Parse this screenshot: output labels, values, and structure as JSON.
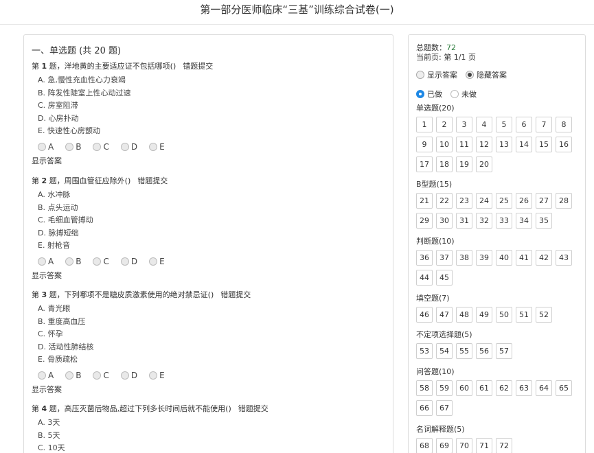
{
  "page": {
    "title": "第一部分医师临床“三基”训练综合试卷(一)"
  },
  "section": {
    "prefix": "一、单选题 (共 ",
    "count": "20",
    "suffix": " 题)"
  },
  "questions": [
    {
      "prefix": "第 ",
      "num": "1",
      "text": " 题，洋地黄的主要适应证不包括哪项()",
      "report": "错题提交",
      "options": [
        "A. 急,慢性充血性心力衰竭",
        "B. 阵发性陡室上性心动过速",
        "C. 房室阻滞",
        "D. 心房扑动",
        "E. 快速性心房颤动"
      ]
    },
    {
      "prefix": "第 ",
      "num": "2",
      "text": " 题，周围血管征应除外()",
      "report": "错题提交",
      "options": [
        "A. 水冲脉",
        "B. 点头运动",
        "C. 毛细血管搏动",
        "D. 脉搏短绌",
        "E. 射枪音"
      ]
    },
    {
      "prefix": "第 ",
      "num": "3",
      "text": " 题，下列哪项不是糖皮质激素使用的绝对禁忌证()",
      "report": "错题提交",
      "options": [
        "A. 青光眼",
        "B. 重度高血压",
        "C. 怀孕",
        "D. 活动性肺结核",
        "E. 骨质疏松"
      ]
    },
    {
      "prefix": "第 ",
      "num": "4",
      "text": " 题，高压灭菌后物品,超过下列多长时间后就不能使用()",
      "report": "错题提交",
      "options": [
        "A. 3天",
        "B. 5天",
        "C. 10天"
      ]
    }
  ],
  "radio_labels": [
    "A",
    "B",
    "C",
    "D",
    "E"
  ],
  "show_answer_label": "显示答案",
  "sidebar": {
    "total_label": "总题数：",
    "total_value": "72",
    "page_label": "当前页: 第 1/1 页",
    "show_answers": "显示答案",
    "hide_answers": "隐藏答案",
    "done": "已做",
    "not_done": "未做",
    "groups": [
      {
        "title": "单选题(20)",
        "numbers": [
          "1",
          "2",
          "3",
          "4",
          "5",
          "6",
          "7",
          "8",
          "9",
          "10",
          "11",
          "12",
          "13",
          "14",
          "15",
          "16",
          "17",
          "18",
          "19",
          "20"
        ]
      },
      {
        "title": "B型题(15)",
        "numbers": [
          "21",
          "22",
          "23",
          "24",
          "25",
          "26",
          "27",
          "28",
          "29",
          "30",
          "31",
          "32",
          "33",
          "34",
          "35"
        ]
      },
      {
        "title": "判断题(10)",
        "numbers": [
          "36",
          "37",
          "38",
          "39",
          "40",
          "41",
          "42",
          "43",
          "44",
          "45"
        ]
      },
      {
        "title": "填空题(7)",
        "numbers": [
          "46",
          "47",
          "48",
          "49",
          "50",
          "51",
          "52"
        ]
      },
      {
        "title": "不定项选择题(5)",
        "numbers": [
          "53",
          "54",
          "55",
          "56",
          "57"
        ]
      },
      {
        "title": "问答题(10)",
        "numbers": [
          "58",
          "59",
          "60",
          "61",
          "62",
          "63",
          "64",
          "65",
          "66",
          "67"
        ]
      },
      {
        "title": "名词解释题(5)",
        "numbers": [
          "68",
          "69",
          "70",
          "71",
          "72"
        ]
      }
    ]
  },
  "colors": {
    "accent_radio": "#1e88e5",
    "count_green": "#2a7a3a"
  }
}
